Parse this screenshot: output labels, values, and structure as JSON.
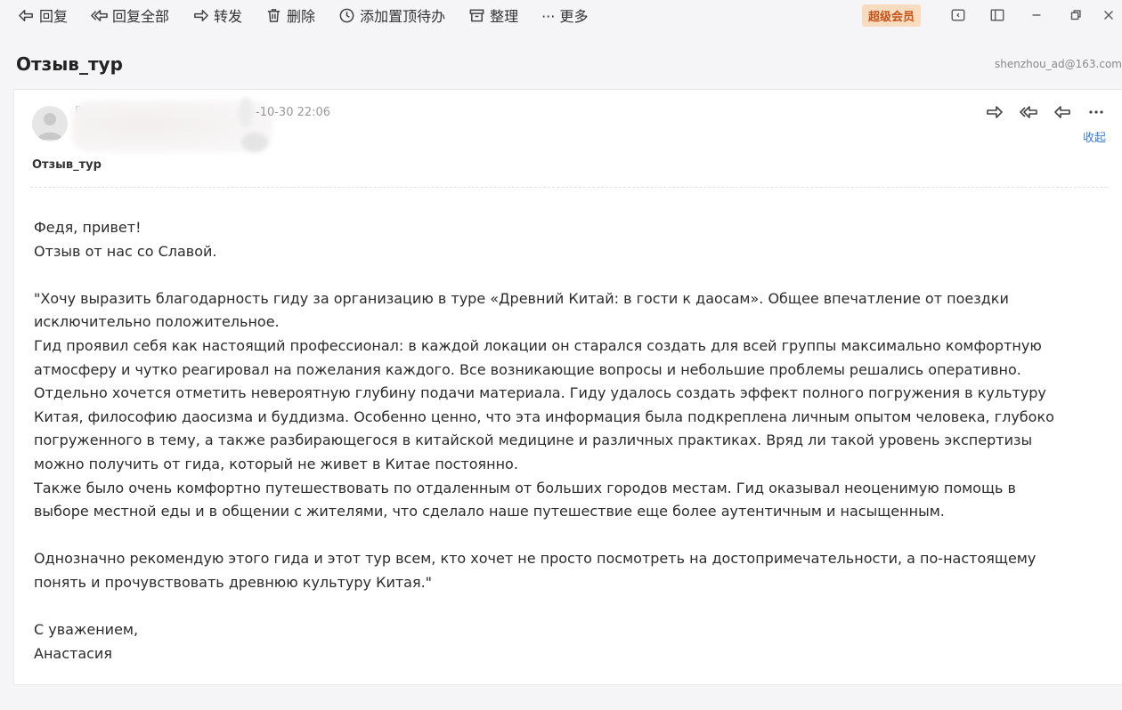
{
  "toolbar": {
    "reply": "回复",
    "reply_all": "回复全部",
    "forward": "转发",
    "delete": "删除",
    "add_todo": "添加置顶待办",
    "organize": "整理",
    "more": "··· 更多",
    "vip_badge": "超级会员",
    "icons": [
      "reply-icon",
      "reply-all-icon",
      "forward-icon",
      "trash-icon",
      "clock-icon",
      "archive-icon",
      "reader-icon",
      "layout-icon",
      "minimize-icon",
      "restore-icon",
      "close-icon"
    ]
  },
  "header": {
    "subject": "Отзыв_тур",
    "account": "shenzhou_ad@163.com"
  },
  "mail": {
    "date_fragment": "-10-30 22:06",
    "sender_fragment": "Р",
    "subject": "Отзыв_тур",
    "collapse": "收起",
    "paragraphs": [
      [
        "Федя, привет!",
        "Отзыв от нас со Славой."
      ],
      [
        "\"Хочу выразить благодарность гиду за организацию в туре «Древний Китай: в гости к даосам». Общее впечатление от поездки",
        "исключительно положительное.",
        "Гид проявил себя как настоящий профессионал: в каждой локации он старался создать для всей группы максимально комфортную",
        "атмосферу и чутко реагировал на пожелания каждого. Все возникающие вопросы и небольшие проблемы решались оперативно.",
        "Отдельно хочется отметить невероятную глубину подачи материала. Гиду удалось создать эффект полного погружения в культуру",
        "Китая, философию даосизма и буддизма. Особенно ценно, что эта информация была подкреплена личным опытом человека, глубоко",
        "погруженного в тему, а также разбирающегося в китайской медицине и различных практиках. Вряд ли такой уровень экспертизы",
        "можно получить от гида, который не живет в Китае постоянно.",
        "Также было очень комфортно путешествовать по отдаленным от больших городов местам. Гид оказывал неоценимую помощь в",
        "выборе местной еды и в общении с жителями, что сделало наше путешествие еще более аутентичным и насыщенным."
      ],
      [
        "Однозначно рекомендую этого гида и этот тур всем, кто хочет не просто посмотреть на достопримечательности, а по-настоящему",
        "понять и прочувствовать древнюю культуру Китая.\""
      ],
      [
        "С уважением,",
        "Анастасия"
      ]
    ]
  }
}
